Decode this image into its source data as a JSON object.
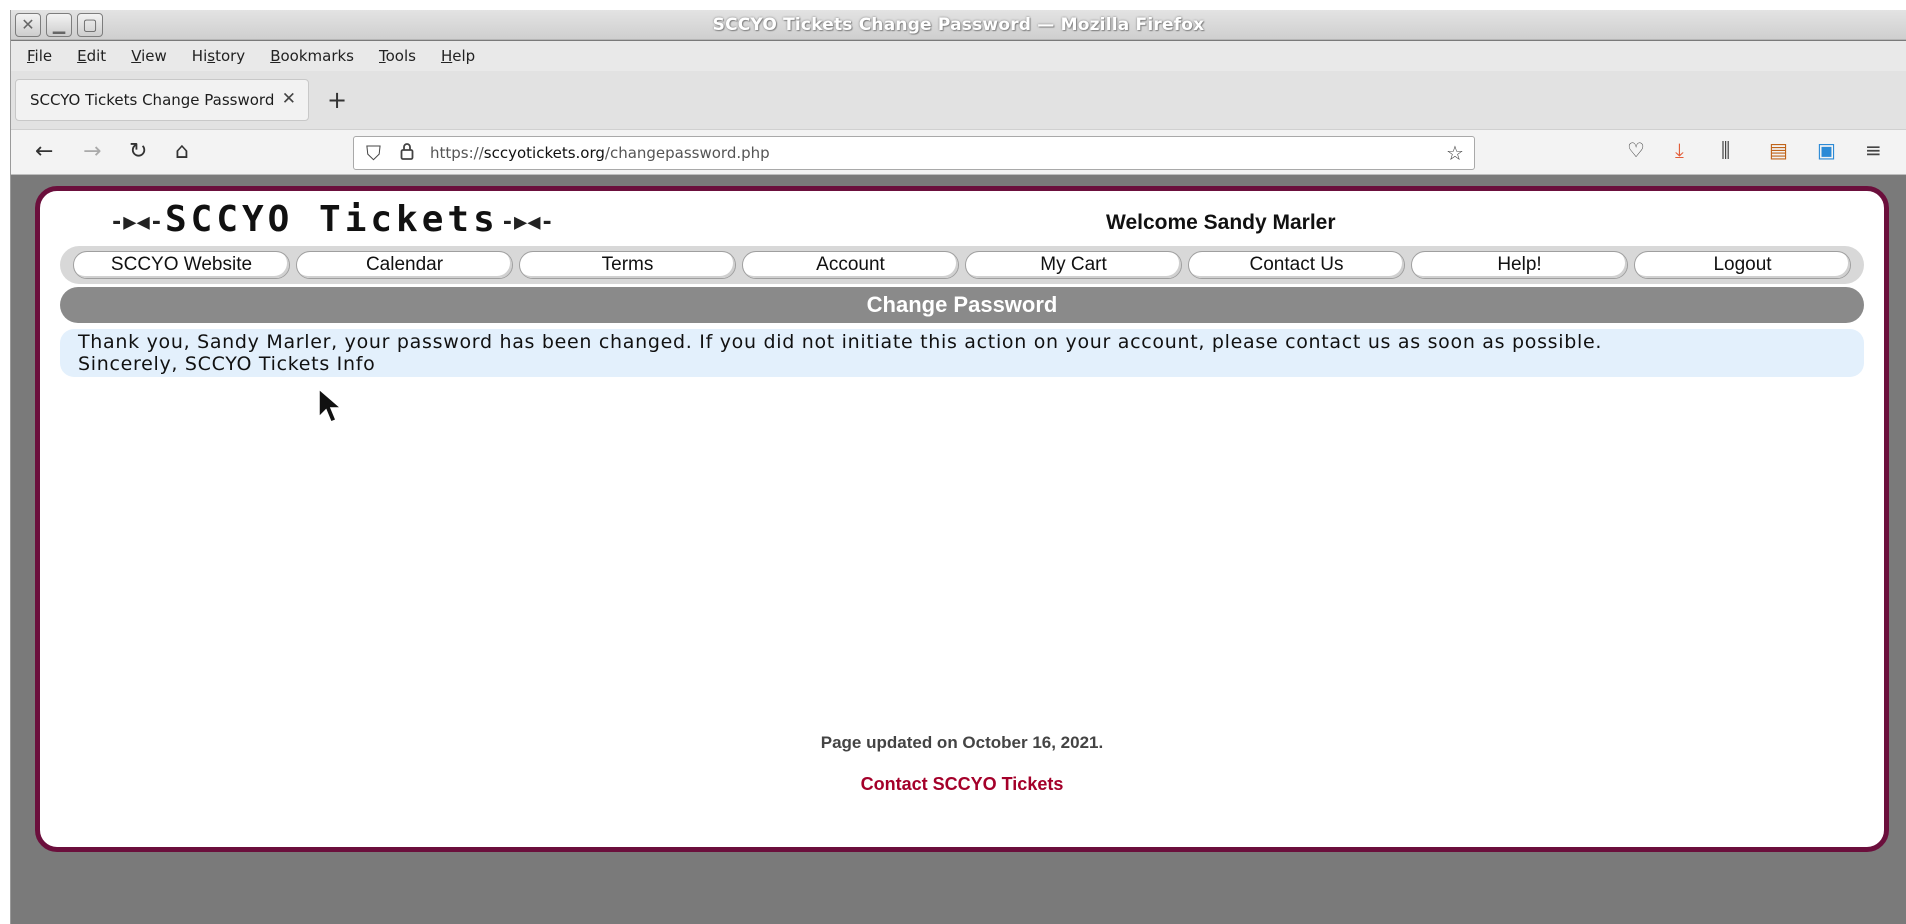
{
  "window": {
    "title": "SCCYO Tickets Change Password — Mozilla Firefox"
  },
  "menu": {
    "items": [
      "File",
      "Edit",
      "View",
      "History",
      "Bookmarks",
      "Tools",
      "Help"
    ],
    "access_keys": [
      "F",
      "E",
      "V",
      "s",
      "B",
      "T",
      "H"
    ]
  },
  "tabs": [
    {
      "label": "SCCYO Tickets Change Password",
      "active": true
    }
  ],
  "urlbar": {
    "prefix": "https://",
    "domain": "sccyotickets.org",
    "path": "/changepassword.php"
  },
  "page": {
    "logo_text": "SCCYO Tickets",
    "welcome": "Welcome Sandy Marler",
    "nav": [
      "SCCYO Website",
      "Calendar",
      "Terms",
      "Account",
      "My Cart",
      "Contact Us",
      "Help!",
      "Logout"
    ],
    "heading": "Change Password",
    "message_line1": "Thank you, Sandy Marler, your password has been changed. If you did not initiate this action on your account, please contact us as soon as possible.",
    "message_line2": "Sincerely, SCCYO Tickets Info",
    "updated": "Page updated on October 16, 2021.",
    "contact_link": "Contact SCCYO Tickets"
  },
  "colors": {
    "page_border": "#6b0f3c",
    "heading_bg": "#8a8a8a",
    "message_bg": "#e3f0fc",
    "contact_link": "#a4002a"
  }
}
